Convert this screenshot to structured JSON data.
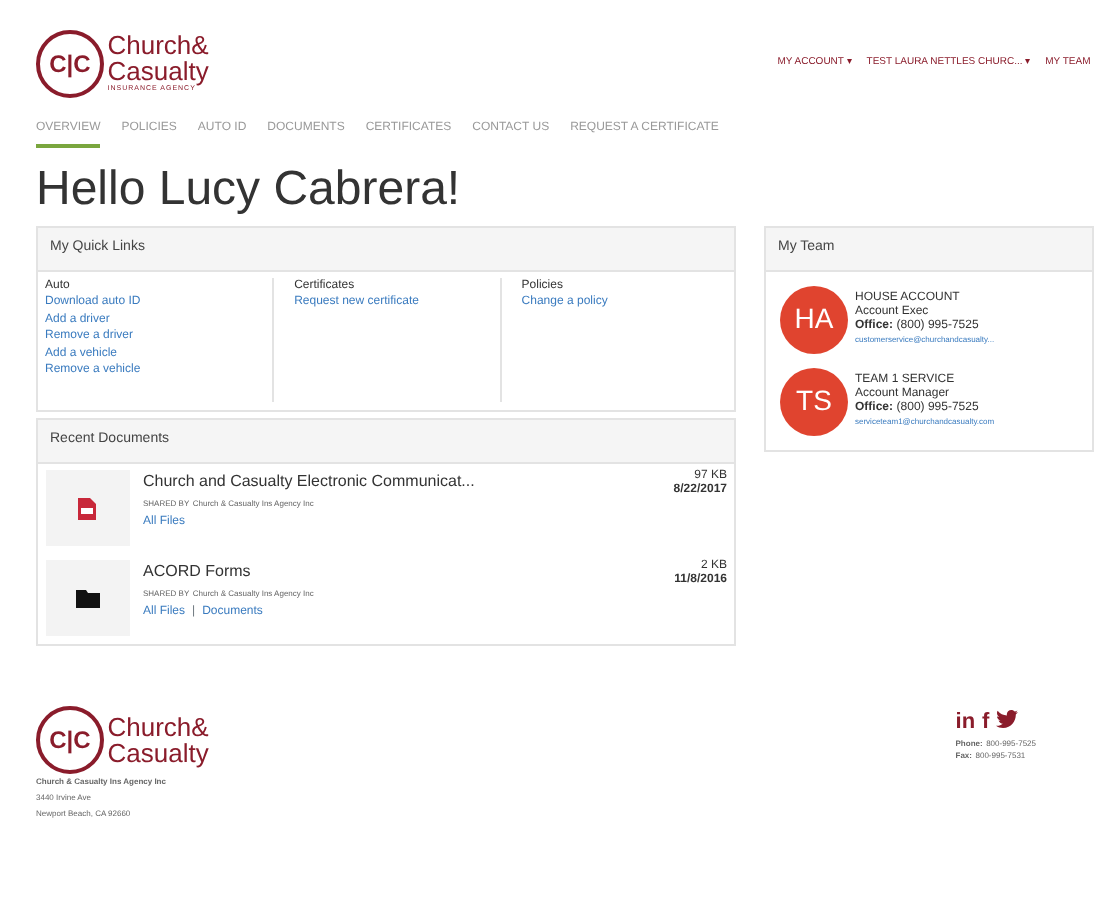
{
  "logo": {
    "mark": "C|C",
    "name_line1": "Church&",
    "name_line2": "Casualty",
    "tagline": "INSURANCE AGENCY"
  },
  "top_menu": [
    {
      "label": "MY ACCOUNT",
      "caret": "▾"
    },
    {
      "label": "TEST LAURA NETTLES CHURC...",
      "caret": "▾"
    },
    {
      "label": "MY TEAM"
    }
  ],
  "tabs": [
    {
      "label": "OVERVIEW",
      "selected": true
    },
    {
      "label": "POLICIES",
      "selected": false
    },
    {
      "label": "AUTO ID",
      "selected": false
    },
    {
      "label": "DOCUMENTS",
      "selected": false
    },
    {
      "label": "CERTIFICATES",
      "selected": false
    },
    {
      "label": "CONTACT US",
      "selected": false
    },
    {
      "label": "REQUEST A CERTIFICATE",
      "selected": false
    }
  ],
  "greeting": "Hello Lucy Cabrera!",
  "quick_links": {
    "title": "My Quick Links",
    "groups": [
      {
        "heading": "Auto",
        "links": [
          "Download auto ID",
          "Add a driver",
          "Remove a driver",
          "Add a vehicle",
          "Remove a vehicle"
        ]
      },
      {
        "heading": "Certificates",
        "links": [
          "Request new certificate"
        ]
      },
      {
        "heading": "Policies",
        "links": [
          "Change a policy"
        ]
      }
    ]
  },
  "recent_documents": {
    "title": "Recent Documents",
    "items": [
      {
        "kind": "pdf",
        "name": "Church and Casualty Electronic Communicat...",
        "shared_label": "SHARED BY",
        "shared_by": "Church & Casualty Ins Agency Inc",
        "links": [
          "All Files"
        ],
        "size": "97 KB",
        "date": "8/22/2017"
      },
      {
        "kind": "folder",
        "name": "ACORD Forms",
        "shared_label": "SHARED BY",
        "shared_by": "Church & Casualty Ins Agency Inc",
        "links": [
          "All Files",
          "Documents"
        ],
        "separator": "|",
        "size": "2 KB",
        "date": "11/8/2016"
      }
    ]
  },
  "team": {
    "title": "My Team",
    "members": [
      {
        "initials": "HA",
        "color": "#e0442f",
        "name": "HOUSE ACCOUNT",
        "role": "Account Exec",
        "office_label": "Office:",
        "phone": "(800) 995-7525",
        "email": "customerservice@churchandcasualty..."
      },
      {
        "initials": "TS",
        "color": "#e0442f",
        "name": "TEAM 1 SERVICE",
        "role": "Account Manager",
        "office_label": "Office:",
        "phone": "(800) 995-7525",
        "email": "serviceteam1@churchandcasualty.com"
      }
    ]
  },
  "footer": {
    "logo": {
      "mark": "C|C",
      "name_line1": "Church&",
      "name_line2": "Casualty"
    },
    "company": "Church & Casualty Ins Agency Inc",
    "address_line1": "3440 Irvine Ave",
    "address_line2": "Newport Beach, CA 92660",
    "social": [
      "in",
      "f"
    ],
    "phone_label": "Phone:",
    "phone": "800-995-7525",
    "fax_label": "Fax:",
    "fax": "800-995-7531"
  }
}
